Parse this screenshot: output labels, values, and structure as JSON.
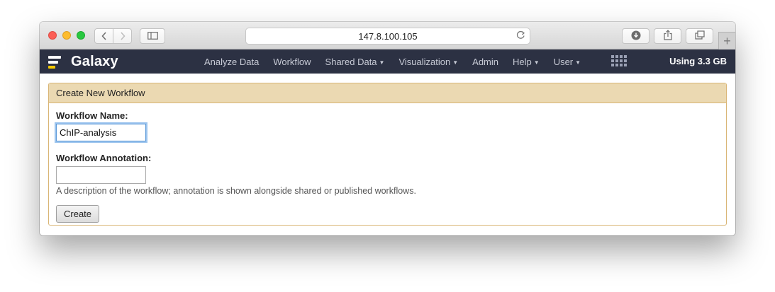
{
  "browser": {
    "url": "147.8.100.105",
    "icons": {
      "back": "chevron-left-icon",
      "forward": "chevron-right-icon",
      "sidebar": "sidebar-icon",
      "reload": "reload-icon",
      "download": "download-icon",
      "share": "share-icon",
      "tabs": "tabs-icon",
      "new_tab": "plus-icon"
    }
  },
  "masthead": {
    "brand": "Galaxy",
    "nav": [
      {
        "label": "Analyze Data"
      },
      {
        "label": "Workflow"
      },
      {
        "label": "Shared Data"
      },
      {
        "label": "Visualization"
      },
      {
        "label": "Admin"
      },
      {
        "label": "Help"
      },
      {
        "label": "User"
      }
    ],
    "quota": "Using 3.3 GB",
    "colors": {
      "background": "#2c3143",
      "brand_accent": "#f5c900"
    }
  },
  "form": {
    "title": "Create New Workflow",
    "name_label": "Workflow Name:",
    "name_value": "ChIP-analysis",
    "annotation_label": "Workflow Annotation:",
    "annotation_value": "",
    "annotation_help": "A description of the workflow; annotation is shown alongside shared or published workflows.",
    "submit_label": "Create",
    "colors": {
      "header_bg": "#ebd9b2",
      "border": "#d9b575"
    }
  }
}
